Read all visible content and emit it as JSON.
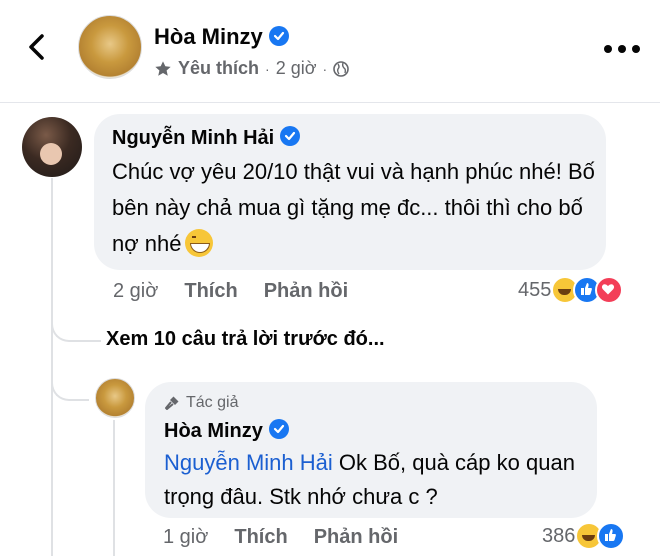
{
  "header": {
    "name": "Hòa Minzy",
    "badge": "Yêu thích",
    "time": "2 giờ"
  },
  "comments": [
    {
      "author": "Nguyễn Minh Hải",
      "text": "Chúc vợ yêu 20/10 thật vui và hạnh phúc nhé! Bố bên này chả mua gì tặng mẹ đc... thôi thì cho bố nợ nhé",
      "time": "2 giờ",
      "like_label": "Thích",
      "reply_label": "Phản hồi",
      "reaction_count": "455"
    },
    {
      "author_badge": "Tác giả",
      "author": "Hòa Minzy",
      "mention": "Nguyễn Minh Hải",
      "text": "Ok Bố, quà cáp ko quan trọng đâu. Stk nhớ chưa c ?",
      "time": "1 giờ",
      "like_label": "Thích",
      "reply_label": "Phản hồi",
      "reaction_count": "386"
    }
  ],
  "see_more": "Xem 10 câu trả lời trước đó...",
  "colors": {
    "accent": "#1877f2",
    "bubble": "#f0f2f5",
    "muted_text": "#65676b",
    "mention": "#1b5fd1"
  }
}
